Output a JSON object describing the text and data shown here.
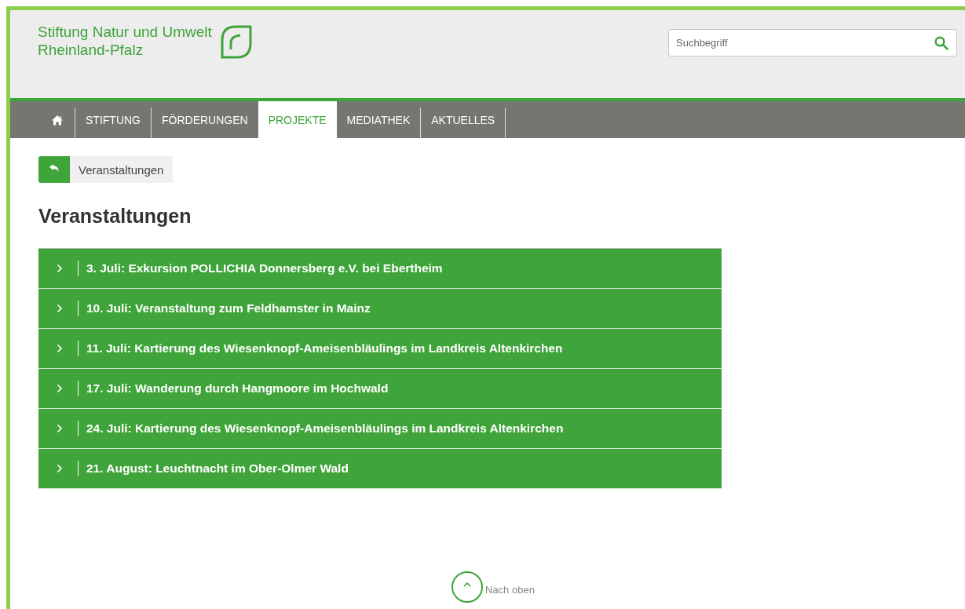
{
  "logo": {
    "line_1": "Stiftung Natur und Umwelt",
    "line_2": "Rheinland-Pfalz"
  },
  "search": {
    "placeholder": "Suchbegriff"
  },
  "nav": [
    {
      "kind": "home",
      "selected": false
    },
    {
      "kind": "text",
      "label": "STIFTUNG",
      "selected": false
    },
    {
      "kind": "text",
      "label": "FÖRDERUNGEN",
      "selected": false
    },
    {
      "kind": "text",
      "label": "PROJEKTE",
      "selected": true
    },
    {
      "kind": "text",
      "label": "MEDIATHEK",
      "selected": false
    },
    {
      "kind": "text",
      "label": "AKTUELLES",
      "selected": false
    }
  ],
  "breadcrumb": {
    "label": "Veranstaltungen"
  },
  "heading": "Veranstaltungen",
  "events": [
    {
      "title": "3. Juli: Exkursion POLLICHIA Donnersberg e.V. bei Ebertheim",
      "expanded": false
    },
    {
      "title": "10. Juli: Veranstaltung zum Feldhamster in Mainz",
      "expanded": false
    },
    {
      "title": "11. Juli: Kartierung des Wiesenknopf-Ameisenbläulings im Landkreis Altenkirchen",
      "expanded": false
    },
    {
      "title": "17. Juli: Wanderung durch Hangmoore im Hochwald",
      "expanded": false
    },
    {
      "title": "24. Juli: Kartierung des Wiesenknopf-Ameisenbläulings im Landkreis Altenkirchen",
      "expanded": false
    },
    {
      "title": "21. August: Leuchtnacht im Ober-Olmer Wald",
      "expanded": false
    }
  ],
  "back_to_top": {
    "label": "Nach oben"
  }
}
